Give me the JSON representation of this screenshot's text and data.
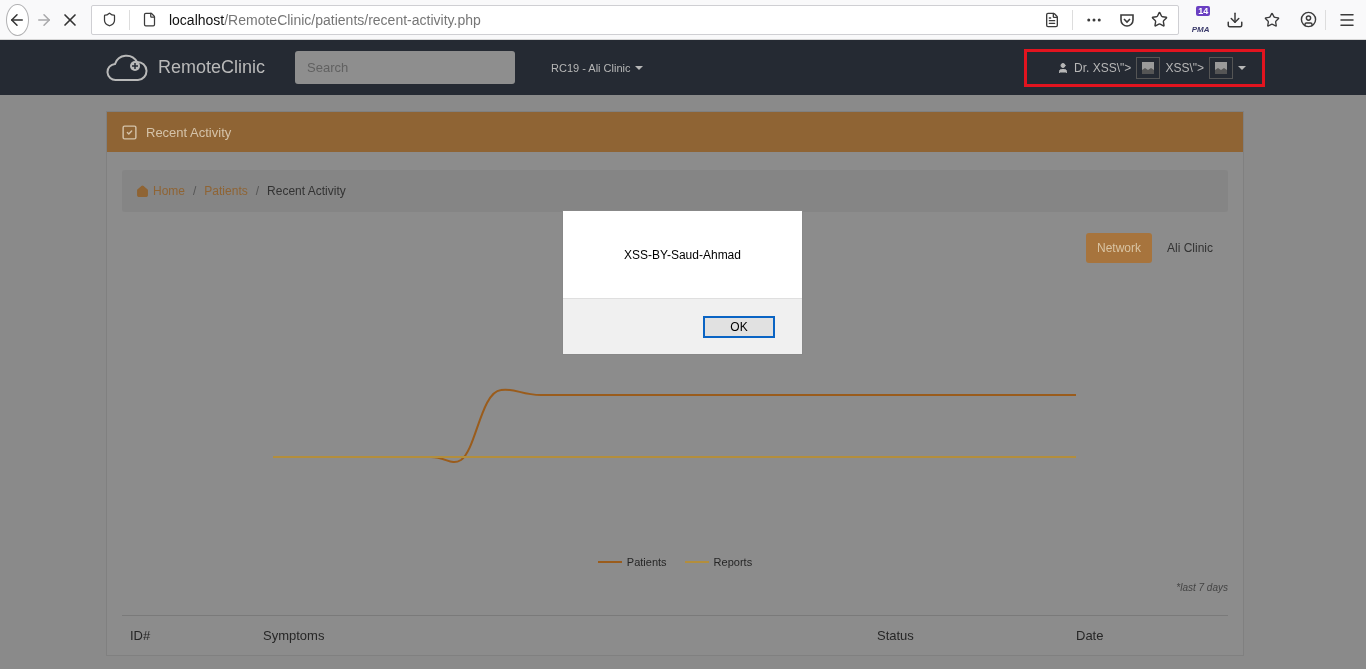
{
  "browser": {
    "url": {
      "host": "localhost",
      "path": "/RemoteClinic/patients/recent-activity.php"
    },
    "pma_badge": {
      "count": "14",
      "label": "PMA"
    }
  },
  "navbar": {
    "brand": "RemoteClinic",
    "search": {
      "placeholder": "Search"
    },
    "clinic_menu": "RC19 - Ali Clinic",
    "user_menu": {
      "parts": [
        "Dr. XSS\\\">",
        "XSS\\\">"
      ],
      "highlighted": true
    }
  },
  "card": {
    "title": "Recent Activity",
    "breadcrumb": [
      {
        "label": "Home",
        "kind": "home"
      },
      {
        "separator": "/",
        "label": "Patients",
        "kind": "link"
      },
      {
        "separator": "/",
        "label": "Recent Activity",
        "kind": "current"
      }
    ],
    "scope_tabs": [
      {
        "label": "Network",
        "selected": true
      },
      {
        "label": "Ali Clinic",
        "selected": false
      }
    ],
    "legend": [
      {
        "name": "Patients",
        "color": "#9a5c1c"
      },
      {
        "name": "Reports",
        "color": "#b38e3c"
      }
    ],
    "note": "*last 7 days",
    "table": {
      "columns": [
        "ID#",
        "Symptoms",
        "Status",
        "Date"
      ]
    }
  },
  "dialog": {
    "message": "XSS-BY-Saud-Ahmad",
    "button": "OK"
  }
}
